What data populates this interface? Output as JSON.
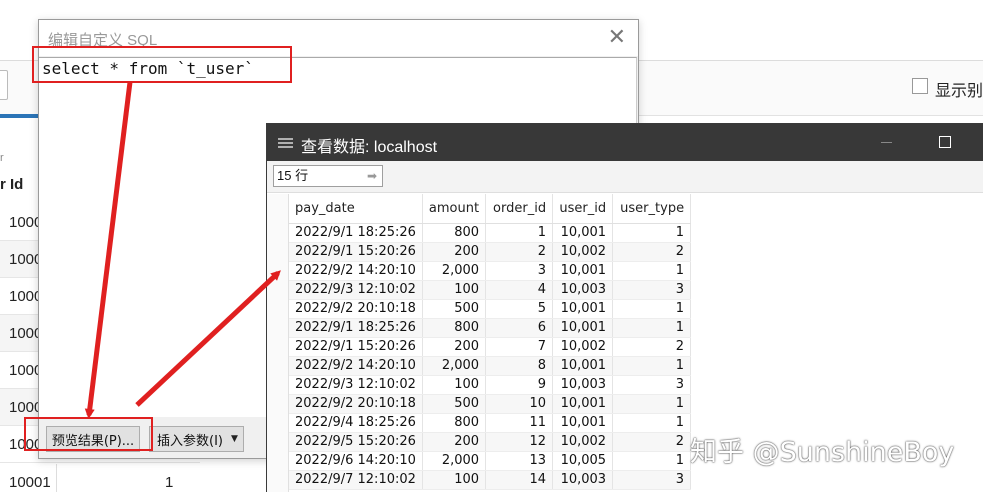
{
  "background": {
    "checkbox_label": "显示别",
    "sub_label": "r",
    "column_header": "r Id",
    "rows": [
      "1000",
      "1000",
      "1000",
      "1000",
      "1000",
      "1000",
      "1000"
    ],
    "last_row": {
      "col1": "10001",
      "col2": "1"
    }
  },
  "sql_dialog": {
    "title": "编辑自定义 SQL",
    "close_label": "✕",
    "sql_text": "select * from `t_user`",
    "preview_button": "预览结果(P)...",
    "insert_button": "插入参数(I)"
  },
  "view_window": {
    "title": "查看数据: localhost",
    "row_count": "15 行",
    "columns": [
      "pay_date",
      "amount",
      "order_id",
      "user_id",
      "user_type"
    ],
    "rows": [
      [
        "2022/9/1 18:25:26",
        "800",
        "1",
        "10,001",
        "1"
      ],
      [
        "2022/9/1 15:20:26",
        "200",
        "2",
        "10,002",
        "2"
      ],
      [
        "2022/9/2 14:20:10",
        "2,000",
        "3",
        "10,001",
        "1"
      ],
      [
        "2022/9/3 12:10:02",
        "100",
        "4",
        "10,003",
        "3"
      ],
      [
        "2022/9/2 20:10:18",
        "500",
        "5",
        "10,001",
        "1"
      ],
      [
        "2022/9/1 18:25:26",
        "800",
        "6",
        "10,001",
        "1"
      ],
      [
        "2022/9/1 15:20:26",
        "200",
        "7",
        "10,002",
        "2"
      ],
      [
        "2022/9/2 14:20:10",
        "2,000",
        "8",
        "10,001",
        "1"
      ],
      [
        "2022/9/3 12:10:02",
        "100",
        "9",
        "10,003",
        "3"
      ],
      [
        "2022/9/2 20:10:18",
        "500",
        "10",
        "10,001",
        "1"
      ],
      [
        "2022/9/4 18:25:26",
        "800",
        "11",
        "10,001",
        "1"
      ],
      [
        "2022/9/5 15:20:26",
        "200",
        "12",
        "10,002",
        "2"
      ],
      [
        "2022/9/6 14:20:10",
        "2,000",
        "13",
        "10,005",
        "1"
      ],
      [
        "2022/9/7 12:10:02",
        "100",
        "14",
        "10,003",
        "3"
      ]
    ]
  },
  "watermark": "知乎 @SunshineBoy",
  "colors": {
    "annotation": "#e02020",
    "titlebar": "#383838",
    "accent": "#2b74b7"
  }
}
